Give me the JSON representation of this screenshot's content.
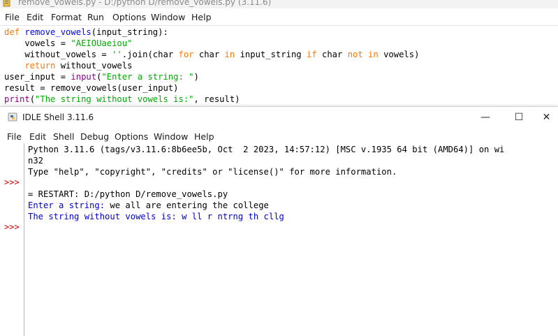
{
  "editor": {
    "title": "remove_vowels.py - D:/python D/remove_vowels.py (3.11.6)",
    "menu": [
      "File",
      "Edit",
      "Format",
      "Run",
      "Options",
      "Window",
      "Help"
    ],
    "code": {
      "l1": {
        "kw": "def",
        "name": "remove_vowels",
        "rest": "(input_string):"
      },
      "l2": {
        "pre": "    vowels = ",
        "str": "\"AEIOUaeiou\""
      },
      "l3": {
        "a": "    without_vowels = ",
        "s": "''",
        "b": ".join(char ",
        "k1": "for",
        "c": " char ",
        "k2": "in",
        "d": " input_string ",
        "k3": "if",
        "e": " char ",
        "k4": "not",
        "f": " ",
        "k5": "in",
        "g": " vowels)"
      },
      "l4": {
        "kw": "    return",
        "rest": " without_vowels"
      },
      "l5": {
        "a": "user_input = ",
        "bi": "input",
        "b": "(",
        "s": "\"Enter a string: \"",
        "c": ")"
      },
      "l6": {
        "a": "result = remove_vowels(user_input)"
      },
      "l7": {
        "bi": "print",
        "a": "(",
        "s": "\"The string without vowels is:\"",
        "b": ", result)"
      }
    }
  },
  "shell": {
    "title": "IDLE Shell 3.11.6",
    "menu": [
      "File",
      "Edit",
      "Shell",
      "Debug",
      "Options",
      "Window",
      "Help"
    ],
    "controls": {
      "minimize": "—",
      "maximize": "☐",
      "close": "✕"
    },
    "prompt": ">>>",
    "lines": {
      "banner1": "Python 3.11.6 (tags/v3.11.6:8b6ee5b, Oct  2 2023, 14:57:12) [MSC v.1935 64 bit (AMD64)] on wi",
      "banner2": "n32",
      "banner3": "Type \"help\", \"copyright\", \"credits\" or \"license()\" for more information.",
      "restart": "= RESTART: D:/python D/remove_vowels.py",
      "prompt_text": "Enter a string: ",
      "user_entry": "we all are entering the college",
      "result": "The string without vowels is: w ll r ntrng th cllg"
    }
  }
}
